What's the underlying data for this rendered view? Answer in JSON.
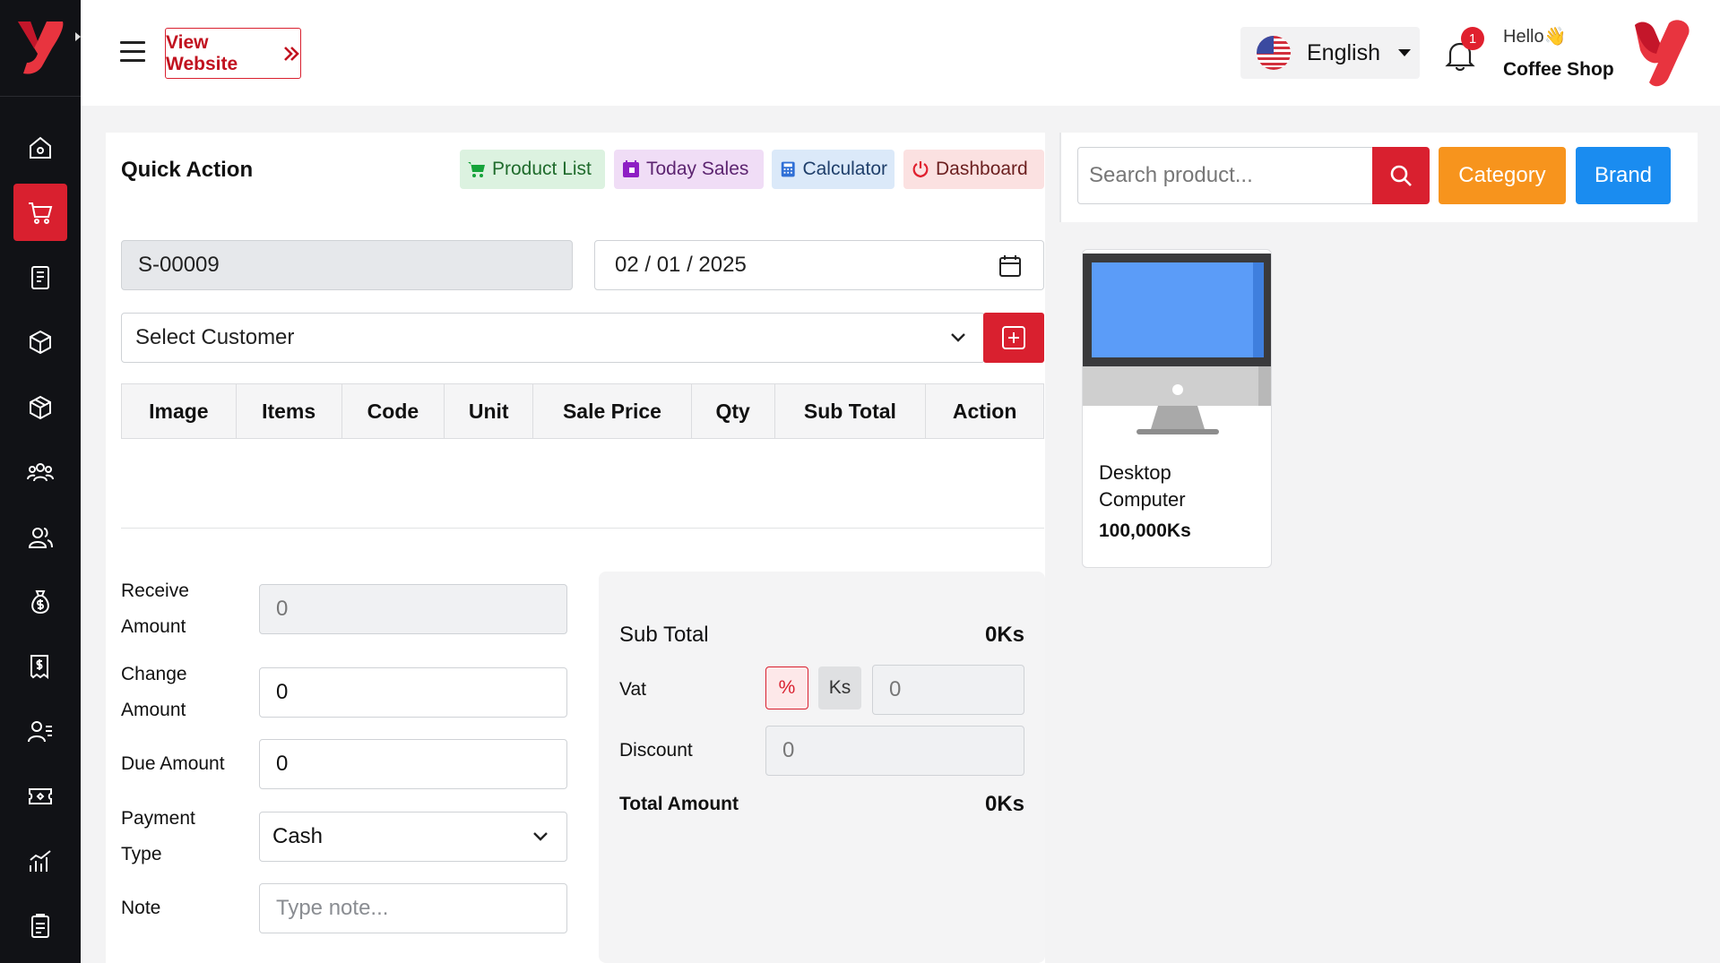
{
  "header": {
    "view_website": "View Website",
    "language": "English",
    "notification_count": "1",
    "greeting": "Hello👋",
    "shop_name": "Coffee Shop"
  },
  "sidebar": {
    "items": [
      {
        "icon": "home-icon",
        "active": false
      },
      {
        "icon": "cart-icon",
        "active": true
      },
      {
        "icon": "receipt-icon",
        "active": false
      },
      {
        "icon": "boxes-icon",
        "active": false
      },
      {
        "icon": "box-icon",
        "active": false
      },
      {
        "icon": "users-group-icon",
        "active": false
      },
      {
        "icon": "users-icon",
        "active": false
      },
      {
        "icon": "money-bag-icon",
        "active": false
      },
      {
        "icon": "invoice-icon",
        "active": false
      },
      {
        "icon": "user-list-icon",
        "active": false
      },
      {
        "icon": "coupon-icon",
        "active": false
      },
      {
        "icon": "chart-icon",
        "active": false
      },
      {
        "icon": "clipboard-icon",
        "active": false
      }
    ]
  },
  "quick_action": {
    "title": "Quick Action",
    "product_list": "Product List",
    "today_sales": "Today Sales",
    "calculator": "Calculator",
    "dashboard": "Dashboard"
  },
  "sale": {
    "invoice_no": "S-00009",
    "date": "02 / 01 / 2025",
    "customer_placeholder": "Select Customer"
  },
  "table": {
    "columns": [
      "Image",
      "Items",
      "Code",
      "Unit",
      "Sale Price",
      "Qty",
      "Sub Total",
      "Action"
    ]
  },
  "payment": {
    "receive_amount_label_1": "Receive",
    "receive_amount_label_2": "Amount",
    "receive_amount_value": "0",
    "change_amount_label_1": "Change",
    "change_amount_label_2": "Amount",
    "change_amount_value": "0",
    "due_amount_label": "Due Amount",
    "due_amount_value": "0",
    "payment_type_label_1": "Payment",
    "payment_type_label_2": "Type",
    "payment_type_value": "Cash",
    "note_label": "Note",
    "note_placeholder": "Type note..."
  },
  "summary": {
    "sub_total_label": "Sub Total",
    "sub_total_value": "0Ks",
    "vat_label": "Vat",
    "vat_percent": "%",
    "vat_ks": "Ks",
    "vat_value": "0",
    "discount_label": "Discount",
    "discount_value": "0",
    "total_label": "Total Amount",
    "total_value": "0Ks"
  },
  "product_panel": {
    "search_placeholder": "Search product...",
    "category": "Category",
    "brand": "Brand"
  },
  "products": [
    {
      "name": "Desktop Computer",
      "price": "100,000Ks"
    }
  ],
  "colors": {
    "primary": "#d9202f",
    "category": "#f7941d",
    "brand": "#1a8cf0",
    "sidebar": "#111216"
  }
}
